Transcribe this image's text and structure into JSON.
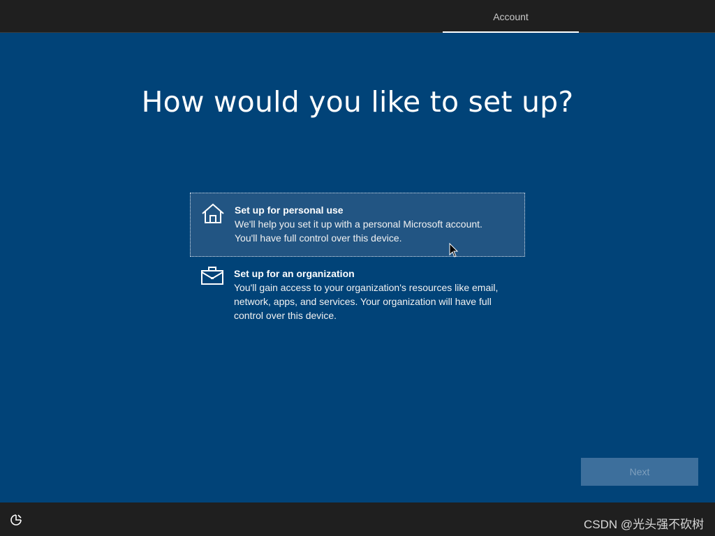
{
  "header": {
    "tab_label": "Account"
  },
  "page": {
    "title": "How would you like to set up?"
  },
  "options": [
    {
      "icon": "home-icon",
      "title": "Set up for personal use",
      "description_lines": [
        "We'll help you set it up with a personal Microsoft account.",
        "You'll have full control over this device."
      ],
      "selected": true
    },
    {
      "icon": "briefcase-icon",
      "title": "Set up for an organization",
      "description_lines": [
        "You'll gain access to your organization's resources like email,",
        "network, apps, and services. Your organization will have full",
        "control over this device."
      ],
      "selected": false
    }
  ],
  "footer": {
    "next_label": "Next",
    "accessibility_icon": "accessibility-icon",
    "watermark": "CSDN @光头强不砍树"
  },
  "colors": {
    "background": "#014378",
    "bar": "#1f1f1f",
    "selected_option": "#225583",
    "button_disabled": "#3d6f9c"
  }
}
